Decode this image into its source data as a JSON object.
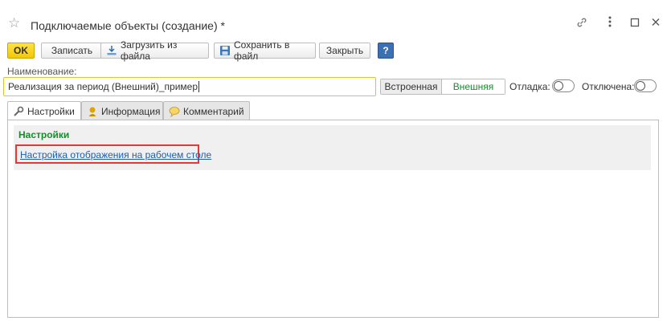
{
  "window": {
    "title": "Подключаемые объекты (создание) *"
  },
  "toolbar": {
    "ok_label": "OK",
    "save_label": "Записать",
    "load_label": "Загрузить из файла",
    "save_file_label": "Сохранить в файл",
    "close_label": "Закрыть",
    "help_label": "?"
  },
  "form": {
    "name_label": "Наименование:",
    "name_value": "Реализация за период (Внешний)_пример",
    "type_options": [
      "Встроенная",
      "Внешняя"
    ],
    "debug_label": "Отладка:",
    "disabled_label": "Отключена:"
  },
  "tabs": [
    {
      "label": "Настройки"
    },
    {
      "label": "Информация"
    },
    {
      "label": "Комментарий"
    }
  ],
  "settings": {
    "group_title": "Настройки",
    "link_text": "Настройка отображения на рабочем столе"
  },
  "colors": {
    "accent_green": "#1a8a2e",
    "ok_yellow": "#f5c800",
    "link_blue": "#1c5fb4",
    "highlight_red": "#e53935"
  }
}
